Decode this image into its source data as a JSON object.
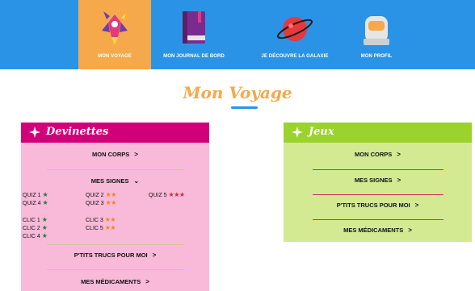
{
  "nav": {
    "items": [
      {
        "label": "MON VOYAGE",
        "icon": "rocket-icon",
        "active": true
      },
      {
        "label": "MON JOURNAL DE BORD",
        "icon": "book-icon",
        "active": false
      },
      {
        "label": "JE DÉCOUVRE LA GALAXIE",
        "icon": "planet-icon",
        "active": false
      },
      {
        "label": "MON PROFIL",
        "icon": "astronaut-helmet-icon",
        "active": false
      }
    ]
  },
  "page": {
    "title": "Mon Voyage"
  },
  "devinettes": {
    "title": "Devinettes",
    "mon_corps": "MON CORPS",
    "mes_signes": "MES SIGNES",
    "quiz": [
      {
        "label": "QUIZ 1",
        "stars": "★",
        "color": "green"
      },
      {
        "label": "QUIZ 2",
        "stars": "★★",
        "color": "orange"
      },
      {
        "label": "QUIZ 5",
        "stars": "★★★",
        "color": "red"
      },
      {
        "label": "QUIZ 4",
        "stars": "★",
        "color": "green"
      },
      {
        "label": "QUIZ 3",
        "stars": "★★",
        "color": "orange"
      }
    ],
    "clic": [
      {
        "label": "CLIC 1",
        "stars": "★",
        "color": "green"
      },
      {
        "label": "CLIC 3",
        "stars": "★★",
        "color": "orange"
      },
      {
        "label": "CLIC 2",
        "stars": "★",
        "color": "green"
      },
      {
        "label": "CLIC 5",
        "stars": "★★",
        "color": "orange"
      },
      {
        "label": "CLIC 4",
        "stars": "★",
        "color": "green"
      }
    ],
    "trucs": "P'TITS TRUCS POUR MOI",
    "medicaments": "MES MÉDICAMENTS"
  },
  "jeux": {
    "title": "Jeux",
    "mon_corps": "MON CORPS",
    "mes_signes": "MES SIGNES",
    "trucs": "P'TITS TRUCS POUR MOI",
    "medicaments": "MES MÉDICAMENTS"
  },
  "colors": {
    "nav_bg": "#2b93e6",
    "active": "#f5a94a",
    "devinettes_head": "#d1007a",
    "devinettes_bg": "#f9b9d9",
    "jeux_head": "#9cd22d",
    "jeux_bg": "#d3ea93"
  }
}
